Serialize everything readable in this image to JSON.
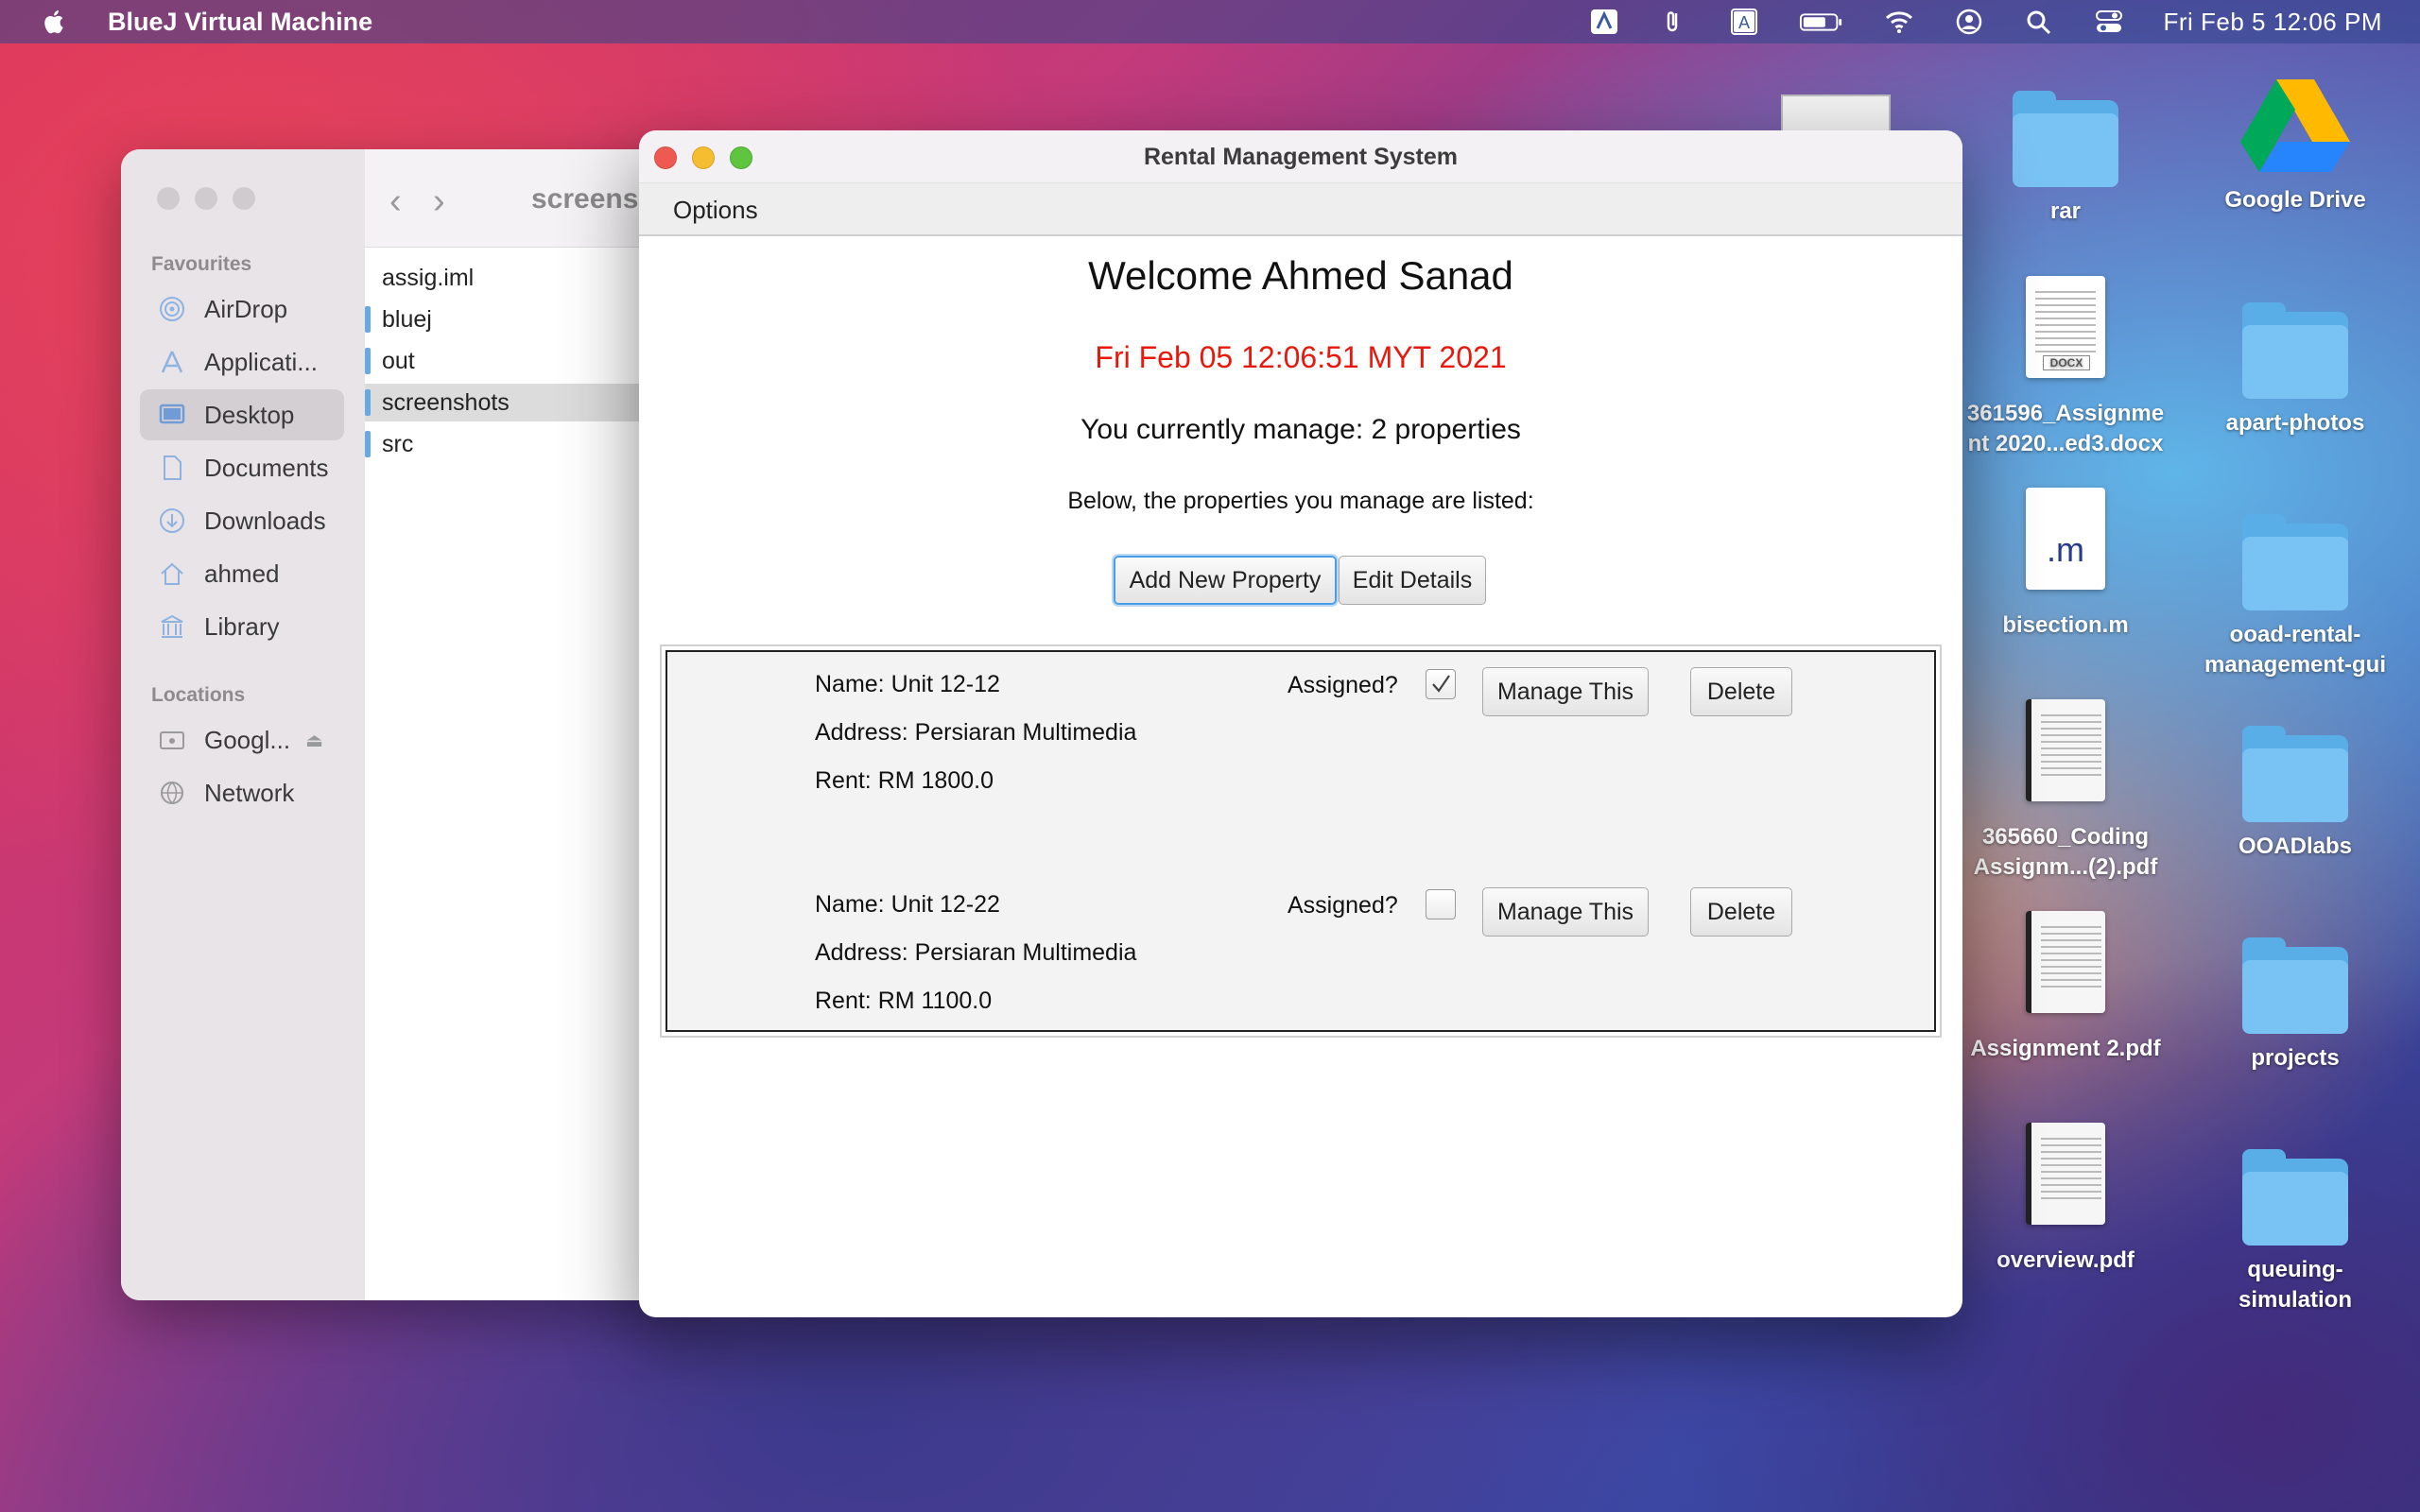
{
  "menubar": {
    "app_name": "BlueJ Virtual Machine",
    "clock": "Fri Feb 5  12:06 PM",
    "status_icons": [
      "text-input-a-icon",
      "paperclip-icon",
      "keyboard-a-icon",
      "battery-icon",
      "wifi-icon",
      "user-icon",
      "spotlight-icon",
      "control-center-icon"
    ]
  },
  "finder": {
    "title": "screens",
    "favourites_header": "Favourites",
    "favourites": [
      {
        "label": "AirDrop",
        "icon": "airdrop-icon"
      },
      {
        "label": "Applicati...",
        "icon": "applications-icon"
      },
      {
        "label": "Desktop",
        "icon": "desktop-icon",
        "selected": true
      },
      {
        "label": "Documents",
        "icon": "document-icon"
      },
      {
        "label": "Downloads",
        "icon": "download-icon"
      },
      {
        "label": "ahmed",
        "icon": "home-icon"
      },
      {
        "label": "Library",
        "icon": "library-icon"
      }
    ],
    "locations_header": "Locations",
    "locations": [
      {
        "label": "Googl...",
        "icon": "drive-icon"
      },
      {
        "label": "Network",
        "icon": "network-icon"
      }
    ],
    "files": [
      {
        "name": "assig.iml",
        "folder": false
      },
      {
        "name": "bluej",
        "folder": true
      },
      {
        "name": "out",
        "folder": true
      },
      {
        "name": "screenshots",
        "folder": true,
        "selected": true
      },
      {
        "name": "src",
        "folder": true
      }
    ]
  },
  "desktop_icons": [
    {
      "label": "rar",
      "type": "folder"
    },
    {
      "label": "Google Drive",
      "type": "drive"
    },
    {
      "label": "361596_Assignme nt 2020...ed3.docx",
      "type": "docx"
    },
    {
      "label": "apart-photos",
      "type": "folder"
    },
    {
      "label": "bisection.m",
      "type": "m-file"
    },
    {
      "label": "ooad-rental-management-gui",
      "type": "folder"
    },
    {
      "label": "365660_Coding Assignm...(2).pdf",
      "type": "pdf"
    },
    {
      "label": "OOADlabs",
      "type": "folder"
    },
    {
      "label": "Assignment 2.pdf",
      "type": "pdf"
    },
    {
      "label": "projects",
      "type": "folder"
    },
    {
      "label": "overview.pdf",
      "type": "pdf"
    },
    {
      "label": "queuing-simulation",
      "type": "folder"
    }
  ],
  "window": {
    "title": "Rental Management System",
    "menu_options": "Options",
    "welcome": "Welcome Ahmed Sanad",
    "datetime": "Fri Feb 05 12:06:51 MYT 2021",
    "manage_count": "You currently manage: 2 properties",
    "list_intro": "Below, the properties you manage are listed:",
    "add_button": "Add New Property",
    "edit_button": "Edit Details",
    "colors": {
      "date": "#e8180c",
      "focus": "#4a9ee8"
    },
    "properties": [
      {
        "name": "Name: Unit 12-12",
        "address": "Address:  Persiaran Multimedia",
        "rent": "Rent: RM 1800.0",
        "assigned_label": "Assigned?",
        "assigned": true,
        "manage": "Manage This",
        "delete": "Delete"
      },
      {
        "name": "Name: Unit 12-22",
        "address": "Address:  Persiaran Multimedia",
        "rent": "Rent: RM 1100.0",
        "assigned_label": "Assigned?",
        "assigned": false,
        "manage": "Manage This",
        "delete": "Delete"
      }
    ]
  }
}
